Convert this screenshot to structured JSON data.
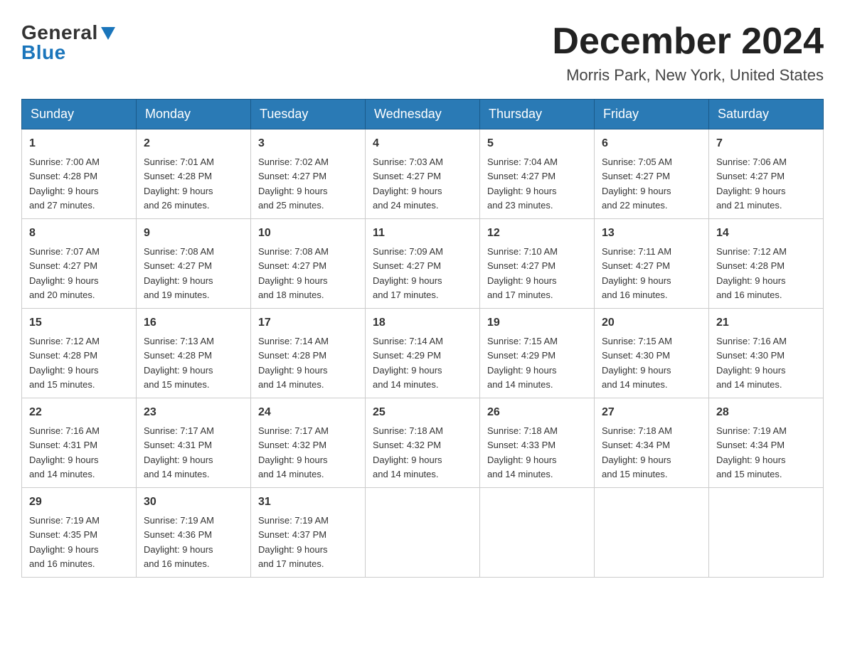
{
  "header": {
    "logo_general": "General",
    "logo_blue": "Blue",
    "title": "December 2024",
    "subtitle": "Morris Park, New York, United States"
  },
  "days_of_week": [
    "Sunday",
    "Monday",
    "Tuesday",
    "Wednesday",
    "Thursday",
    "Friday",
    "Saturday"
  ],
  "weeks": [
    [
      {
        "day": "1",
        "sunrise": "7:00 AM",
        "sunset": "4:28 PM",
        "daylight": "9 hours and 27 minutes."
      },
      {
        "day": "2",
        "sunrise": "7:01 AM",
        "sunset": "4:28 PM",
        "daylight": "9 hours and 26 minutes."
      },
      {
        "day": "3",
        "sunrise": "7:02 AM",
        "sunset": "4:27 PM",
        "daylight": "9 hours and 25 minutes."
      },
      {
        "day": "4",
        "sunrise": "7:03 AM",
        "sunset": "4:27 PM",
        "daylight": "9 hours and 24 minutes."
      },
      {
        "day": "5",
        "sunrise": "7:04 AM",
        "sunset": "4:27 PM",
        "daylight": "9 hours and 23 minutes."
      },
      {
        "day": "6",
        "sunrise": "7:05 AM",
        "sunset": "4:27 PM",
        "daylight": "9 hours and 22 minutes."
      },
      {
        "day": "7",
        "sunrise": "7:06 AM",
        "sunset": "4:27 PM",
        "daylight": "9 hours and 21 minutes."
      }
    ],
    [
      {
        "day": "8",
        "sunrise": "7:07 AM",
        "sunset": "4:27 PM",
        "daylight": "9 hours and 20 minutes."
      },
      {
        "day": "9",
        "sunrise": "7:08 AM",
        "sunset": "4:27 PM",
        "daylight": "9 hours and 19 minutes."
      },
      {
        "day": "10",
        "sunrise": "7:08 AM",
        "sunset": "4:27 PM",
        "daylight": "9 hours and 18 minutes."
      },
      {
        "day": "11",
        "sunrise": "7:09 AM",
        "sunset": "4:27 PM",
        "daylight": "9 hours and 17 minutes."
      },
      {
        "day": "12",
        "sunrise": "7:10 AM",
        "sunset": "4:27 PM",
        "daylight": "9 hours and 17 minutes."
      },
      {
        "day": "13",
        "sunrise": "7:11 AM",
        "sunset": "4:27 PM",
        "daylight": "9 hours and 16 minutes."
      },
      {
        "day": "14",
        "sunrise": "7:12 AM",
        "sunset": "4:28 PM",
        "daylight": "9 hours and 16 minutes."
      }
    ],
    [
      {
        "day": "15",
        "sunrise": "7:12 AM",
        "sunset": "4:28 PM",
        "daylight": "9 hours and 15 minutes."
      },
      {
        "day": "16",
        "sunrise": "7:13 AM",
        "sunset": "4:28 PM",
        "daylight": "9 hours and 15 minutes."
      },
      {
        "day": "17",
        "sunrise": "7:14 AM",
        "sunset": "4:28 PM",
        "daylight": "9 hours and 14 minutes."
      },
      {
        "day": "18",
        "sunrise": "7:14 AM",
        "sunset": "4:29 PM",
        "daylight": "9 hours and 14 minutes."
      },
      {
        "day": "19",
        "sunrise": "7:15 AM",
        "sunset": "4:29 PM",
        "daylight": "9 hours and 14 minutes."
      },
      {
        "day": "20",
        "sunrise": "7:15 AM",
        "sunset": "4:30 PM",
        "daylight": "9 hours and 14 minutes."
      },
      {
        "day": "21",
        "sunrise": "7:16 AM",
        "sunset": "4:30 PM",
        "daylight": "9 hours and 14 minutes."
      }
    ],
    [
      {
        "day": "22",
        "sunrise": "7:16 AM",
        "sunset": "4:31 PM",
        "daylight": "9 hours and 14 minutes."
      },
      {
        "day": "23",
        "sunrise": "7:17 AM",
        "sunset": "4:31 PM",
        "daylight": "9 hours and 14 minutes."
      },
      {
        "day": "24",
        "sunrise": "7:17 AM",
        "sunset": "4:32 PM",
        "daylight": "9 hours and 14 minutes."
      },
      {
        "day": "25",
        "sunrise": "7:18 AM",
        "sunset": "4:32 PM",
        "daylight": "9 hours and 14 minutes."
      },
      {
        "day": "26",
        "sunrise": "7:18 AM",
        "sunset": "4:33 PM",
        "daylight": "9 hours and 14 minutes."
      },
      {
        "day": "27",
        "sunrise": "7:18 AM",
        "sunset": "4:34 PM",
        "daylight": "9 hours and 15 minutes."
      },
      {
        "day": "28",
        "sunrise": "7:19 AM",
        "sunset": "4:34 PM",
        "daylight": "9 hours and 15 minutes."
      }
    ],
    [
      {
        "day": "29",
        "sunrise": "7:19 AM",
        "sunset": "4:35 PM",
        "daylight": "9 hours and 16 minutes."
      },
      {
        "day": "30",
        "sunrise": "7:19 AM",
        "sunset": "4:36 PM",
        "daylight": "9 hours and 16 minutes."
      },
      {
        "day": "31",
        "sunrise": "7:19 AM",
        "sunset": "4:37 PM",
        "daylight": "9 hours and 17 minutes."
      },
      null,
      null,
      null,
      null
    ]
  ],
  "labels": {
    "sunrise": "Sunrise:",
    "sunset": "Sunset:",
    "daylight": "Daylight:"
  }
}
